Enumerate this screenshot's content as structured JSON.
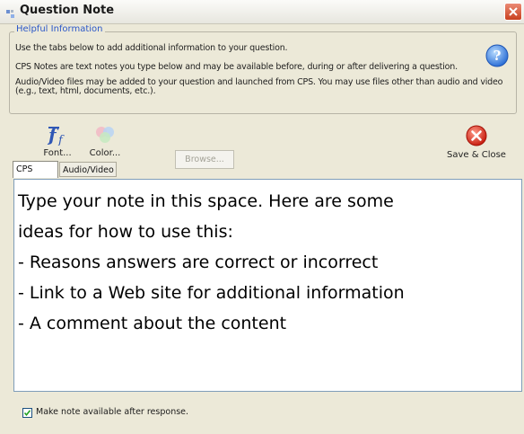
{
  "window": {
    "title": "Question Note"
  },
  "info_group": {
    "legend": "Helpful Information",
    "lines": [
      "Use the tabs below to add additional information to your question.",
      "CPS Notes are text notes you type below and may be available before, during or after delivering a question.",
      "Audio/Video files may be added to your question and launched from CPS. You may use files other than audio and video",
      "(e.g., text, html, documents, etc.)."
    ],
    "help_icon": "question-mark"
  },
  "toolbar": {
    "font_label": "Font...",
    "color_label": "Color...",
    "browse_label": "Browse...",
    "save_close_label": "Save & Close"
  },
  "tabs": [
    {
      "label": "CPS Note",
      "active": true
    },
    {
      "label": "Audio/Video",
      "active": false
    }
  ],
  "note": {
    "lines": [
      "Type your note in this space. Here are some",
      "ideas for how to use this:",
      "- Reasons answers are correct or incorrect",
      "- Link to a Web site for additional information",
      "- A comment about the content"
    ]
  },
  "availability": {
    "label": "Make note available after response.",
    "checked": true
  },
  "colors": {
    "window_bg": "#ece9d8",
    "legend_text": "#2b57c8",
    "close_red": "#c9411f"
  }
}
